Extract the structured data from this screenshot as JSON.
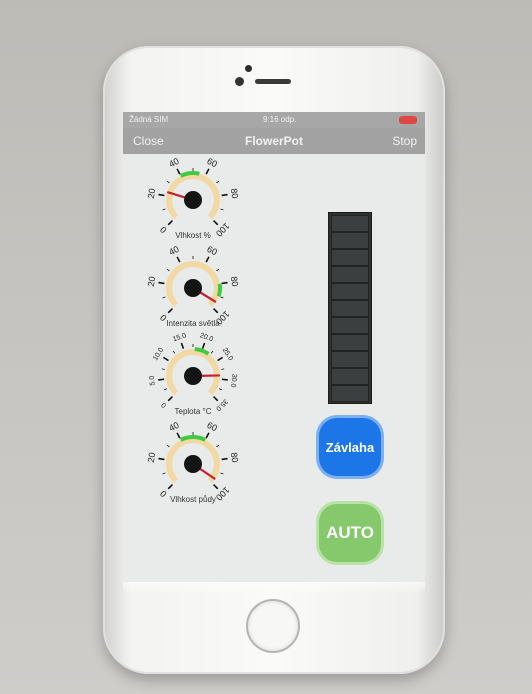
{
  "status_bar": {
    "carrier": "Žádná SIM",
    "time": "9:16 odp."
  },
  "nav": {
    "close_label": "Close",
    "title": "FlowerPot",
    "stop_label": "Stop"
  },
  "gauges": [
    {
      "label": "Vlhkost %",
      "ticks": [
        "0",
        "20",
        "40",
        "60",
        "80",
        "100"
      ],
      "min": 0,
      "max": 100,
      "value": 23,
      "green": [
        40,
        55
      ]
    },
    {
      "label": "Intenzita světla",
      "ticks": [
        "0",
        "20",
        "40",
        "60",
        "80",
        "100"
      ],
      "min": 0,
      "max": 100,
      "value": 95,
      "green": [
        80,
        90
      ]
    },
    {
      "label": "Teplota °C",
      "ticks": [
        "0",
        "5.0",
        "10.0",
        "15.0",
        "20.0",
        "25.0",
        "30.0",
        "35.0"
      ],
      "min": 0,
      "max": 35,
      "value": 29,
      "green": [
        18,
        22
      ]
    },
    {
      "label": "Vlhkost půdy",
      "ticks": [
        "0",
        "20",
        "40",
        "60",
        "80",
        "100"
      ],
      "min": 0,
      "max": 100,
      "value": 96,
      "green": [
        40,
        60
      ]
    }
  ],
  "buttons": {
    "water_label": "Závlaha",
    "auto_label": "AUTO"
  },
  "colors": {
    "accent_blue": "#1c76e8",
    "auto_green": "#86c86c",
    "gauge_green": "#3fcb3f",
    "gauge_band": "#f2d9a4",
    "needle": "#c8202a"
  }
}
